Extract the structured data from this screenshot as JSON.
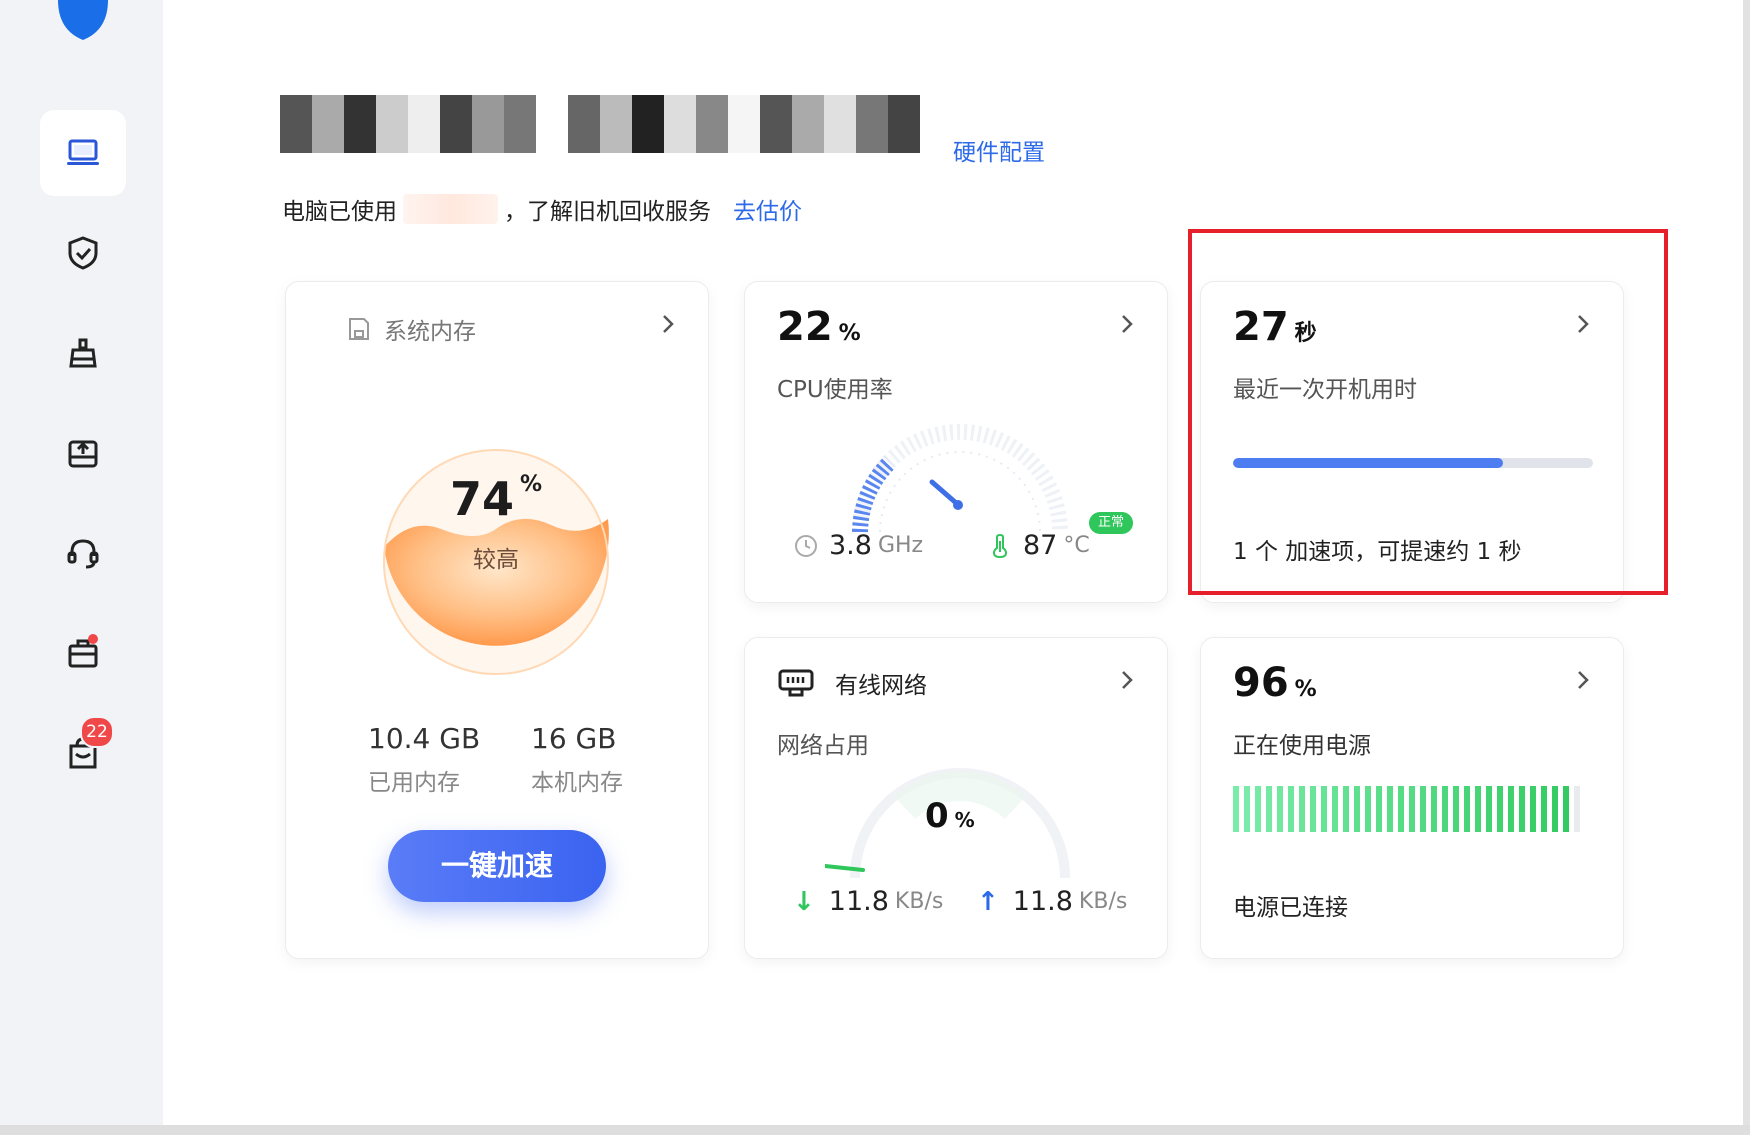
{
  "header": {
    "hardware_link": "硬件配置",
    "usage_prefix": "电脑已使用",
    "usage_suffix": "，了解旧机回收服务",
    "estimate_link": "去估价"
  },
  "sidebar": {
    "items": [
      {
        "name": "monitor-icon",
        "active": true
      },
      {
        "name": "shield-icon"
      },
      {
        "name": "broom-icon"
      },
      {
        "name": "drive-icon"
      },
      {
        "name": "headset-icon"
      },
      {
        "name": "toolbox-icon",
        "dot": true
      },
      {
        "name": "shopping-bag-icon",
        "badge": "22"
      }
    ]
  },
  "memory": {
    "title": "系统内存",
    "percent": "74",
    "percent_unit": "%",
    "level": "较高",
    "used_value": "10.4 GB",
    "used_label": "已用内存",
    "total_value": "16 GB",
    "total_label": "本机内存",
    "boost_button": "一键加速"
  },
  "cpu": {
    "percent": "22",
    "percent_unit": "%",
    "label": "CPU使用率",
    "freq_value": "3.8",
    "freq_unit": "GHz",
    "temp_value": "87",
    "temp_unit": "°C",
    "status": "正常"
  },
  "boot": {
    "value": "27",
    "unit": "秒",
    "label": "最近一次开机用时",
    "progress": 0.75,
    "footer": "1 个 加速项，可提速约 1 秒"
  },
  "network": {
    "title": "有线网络",
    "label": "网络占用",
    "percent": "0",
    "percent_unit": "%",
    "down_value": "11.8",
    "down_unit": "KB/s",
    "up_value": "11.8",
    "up_unit": "KB/s"
  },
  "power": {
    "percent": "96",
    "percent_unit": "%",
    "label": "正在使用电源",
    "footer": "电源已连接",
    "level": 0.96
  },
  "colors": {
    "accent": "#2d6ae8",
    "highlight": "#e5202b",
    "memory_orange": "#ffa35c",
    "battery_green": "#3ed978"
  }
}
